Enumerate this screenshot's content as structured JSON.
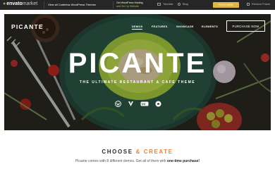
{
  "envato_bar": {
    "logo": "envato",
    "logo_suffix": "market",
    "link": "View all Codeless WordPress Themes",
    "hosting_line1": "Get WordPress Hosting",
    "hosting_line2": "and Set Up Website",
    "tutorials": "Tutorials",
    "blog": "Blog",
    "purchase": "PURCHASE",
    "remove_frame": "Remove Frame"
  },
  "hero": {
    "brand": "PICANTE",
    "nav": [
      "DEMOS",
      "FEATURES",
      "SHOWCASE",
      "ELEMENTS"
    ],
    "active_nav": "DEMOS",
    "purchase_button": "PURCHASE NOW",
    "title": "PICANTE",
    "subtitle": "THE ULTIMATE RESTAURANT & CAFE THEME",
    "badges": [
      "wordpress-icon",
      "vc-icon",
      "woo-icon",
      "wpml-icon"
    ]
  },
  "section": {
    "title_part1": "CHOOSE",
    "title_amp": "&",
    "title_part2": "CREATE",
    "desc_prefix": "Picante comes with 8 different demos. Get all of them with",
    "desc_bold": "one-time purchase!"
  },
  "colors": {
    "accent": "#e9833a",
    "envato_green": "#82b541",
    "purchase_yellow": "#e0b543",
    "dark_bar": "#262626"
  }
}
